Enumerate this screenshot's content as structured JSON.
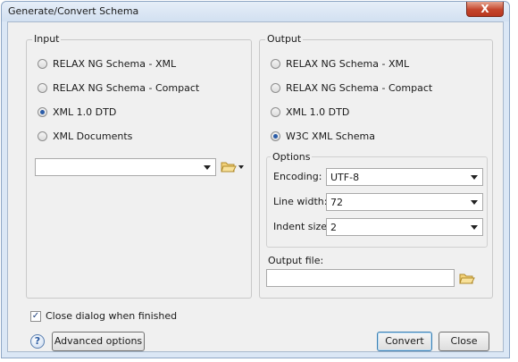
{
  "window": {
    "title": "Generate/Convert Schema",
    "close_glyph": "X"
  },
  "input": {
    "legend": "Input",
    "options": [
      {
        "label": "RELAX NG Schema - XML",
        "checked": false
      },
      {
        "label": "RELAX NG Schema - Compact",
        "checked": false
      },
      {
        "label": "XML 1.0 DTD",
        "checked": true
      },
      {
        "label": "XML Documents",
        "checked": false
      }
    ],
    "file_value": ""
  },
  "output": {
    "legend": "Output",
    "options": [
      {
        "label": "RELAX NG Schema - XML",
        "checked": false
      },
      {
        "label": "RELAX NG Schema - Compact",
        "checked": false
      },
      {
        "label": "XML 1.0 DTD",
        "checked": false
      },
      {
        "label": "W3C XML Schema",
        "checked": true
      }
    ],
    "options_group": {
      "legend": "Options",
      "encoding_label": "Encoding:",
      "encoding_value": "UTF-8",
      "line_width_label": "Line width:",
      "line_width_value": "72",
      "indent_size_label": "Indent size:",
      "indent_size_value": "2"
    },
    "output_file_label": "Output file:",
    "output_file_value": ""
  },
  "footer": {
    "close_when_finished_label": "Close dialog when finished",
    "close_when_finished_checked": true,
    "help_glyph": "?",
    "advanced_label": "Advanced options",
    "convert_label": "Convert",
    "close_label": "Close"
  },
  "icons": {
    "folder": "folder-open-icon",
    "help": "help-icon"
  },
  "colors": {
    "accent": "#2a5ca8",
    "close_button": "#c4452c",
    "window_frame": "#dbe7f5"
  }
}
